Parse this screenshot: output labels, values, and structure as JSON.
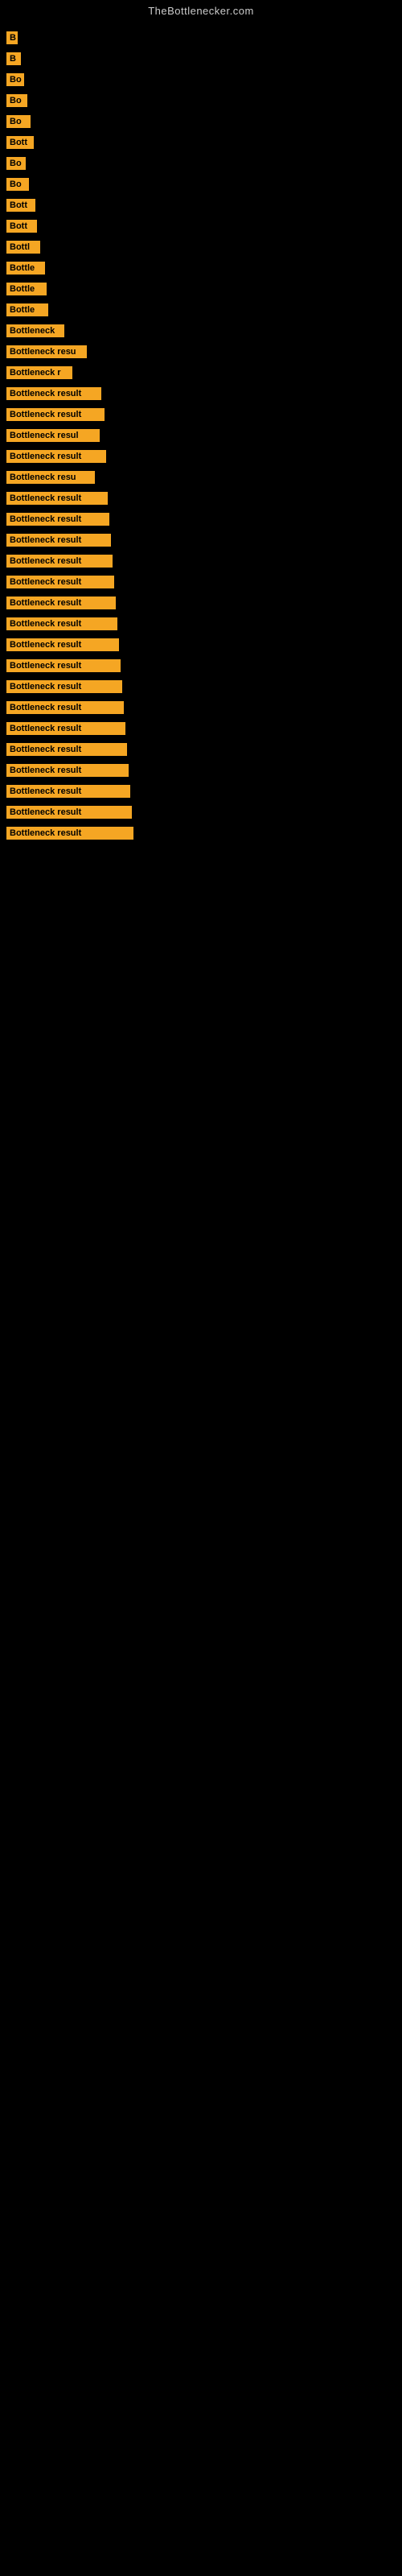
{
  "site": {
    "title": "TheBottlenecker.com"
  },
  "items": [
    {
      "label": "B",
      "width": 14
    },
    {
      "label": "B",
      "width": 18
    },
    {
      "label": "Bo",
      "width": 22
    },
    {
      "label": "Bo",
      "width": 26
    },
    {
      "label": "Bo",
      "width": 30
    },
    {
      "label": "Bott",
      "width": 34
    },
    {
      "label": "Bo",
      "width": 24
    },
    {
      "label": "Bo",
      "width": 28
    },
    {
      "label": "Bott",
      "width": 36
    },
    {
      "label": "Bott",
      "width": 38
    },
    {
      "label": "Bottl",
      "width": 42
    },
    {
      "label": "Bottle",
      "width": 48
    },
    {
      "label": "Bottle",
      "width": 50
    },
    {
      "label": "Bottle",
      "width": 52
    },
    {
      "label": "Bottleneck",
      "width": 72
    },
    {
      "label": "Bottleneck resu",
      "width": 100
    },
    {
      "label": "Bottleneck r",
      "width": 82
    },
    {
      "label": "Bottleneck result",
      "width": 118
    },
    {
      "label": "Bottleneck result",
      "width": 122
    },
    {
      "label": "Bottleneck resul",
      "width": 116
    },
    {
      "label": "Bottleneck result",
      "width": 124
    },
    {
      "label": "Bottleneck resu",
      "width": 110
    },
    {
      "label": "Bottleneck result",
      "width": 126
    },
    {
      "label": "Bottleneck result",
      "width": 128
    },
    {
      "label": "Bottleneck result",
      "width": 130
    },
    {
      "label": "Bottleneck result",
      "width": 132
    },
    {
      "label": "Bottleneck result",
      "width": 134
    },
    {
      "label": "Bottleneck result",
      "width": 136
    },
    {
      "label": "Bottleneck result",
      "width": 138
    },
    {
      "label": "Bottleneck result",
      "width": 140
    },
    {
      "label": "Bottleneck result",
      "width": 142
    },
    {
      "label": "Bottleneck result",
      "width": 144
    },
    {
      "label": "Bottleneck result",
      "width": 146
    },
    {
      "label": "Bottleneck result",
      "width": 148
    },
    {
      "label": "Bottleneck result",
      "width": 150
    },
    {
      "label": "Bottleneck result",
      "width": 152
    },
    {
      "label": "Bottleneck result",
      "width": 154
    },
    {
      "label": "Bottleneck result",
      "width": 156
    },
    {
      "label": "Bottleneck result",
      "width": 158
    }
  ]
}
